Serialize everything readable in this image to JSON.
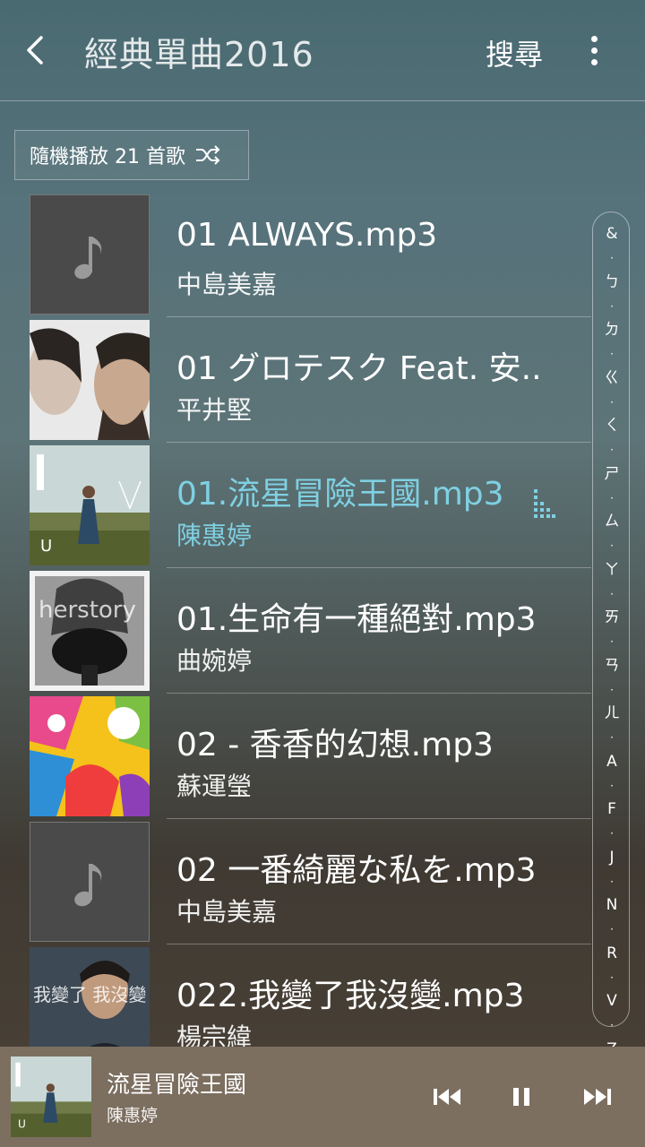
{
  "header": {
    "title": "經典單曲2016",
    "search_label": "搜尋"
  },
  "shuffle": {
    "label": "隨機播放 21 首歌"
  },
  "songs": [
    {
      "title": "01 ALWAYS.mp3",
      "artist": "中島美嘉"
    },
    {
      "title": "01 グロテスク Feat. 安..",
      "artist": "平井堅"
    },
    {
      "title": "01.流星冒險王國.mp3",
      "artist": "陳惠婷"
    },
    {
      "title": "01.生命有一種絕對.mp3",
      "artist": "曲婉婷"
    },
    {
      "title": "02 - 香香的幻想.mp3",
      "artist": "蘇運瑩"
    },
    {
      "title": "02 一番綺麗な私を.mp3",
      "artist": "中島美嘉"
    },
    {
      "title": "022.我變了我沒變.mp3",
      "artist": "楊宗緯"
    }
  ],
  "album_art_text": {
    "row4": "herstory",
    "row7": "我變了 我沒變"
  },
  "index_letters": [
    "&",
    "ㄅ",
    "ㄉ",
    "ㄍ",
    "ㄑ",
    "ㄕ",
    "ㄙ",
    "ㄚ",
    "ㄞ",
    "ㄢ",
    "ㄦ",
    "A",
    "F",
    "J",
    "N",
    "R",
    "V",
    "Z"
  ],
  "now_playing": {
    "title": "流星冒險王國",
    "artist": "陳惠婷"
  },
  "colors": {
    "accent": "#7fd0e2",
    "player_bg": "#7c6f60"
  }
}
